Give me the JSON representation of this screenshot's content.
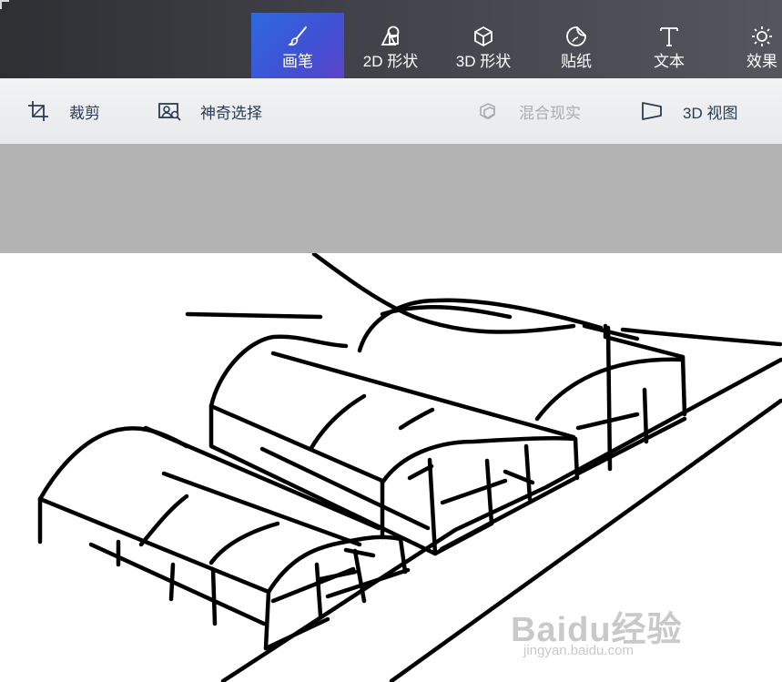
{
  "tabs": [
    {
      "id": "brushes",
      "label": "画笔",
      "icon": "brush-icon",
      "active": true
    },
    {
      "id": "shapes2d",
      "label": "2D 形状",
      "icon": "2d-shapes-icon",
      "active": false
    },
    {
      "id": "shapes3d",
      "label": "3D 形状",
      "icon": "3d-cube-icon",
      "active": false
    },
    {
      "id": "stickers",
      "label": "贴纸",
      "icon": "sticker-icon",
      "active": false
    },
    {
      "id": "text",
      "label": "文本",
      "icon": "text-icon",
      "active": false
    },
    {
      "id": "effects",
      "label": "效果",
      "icon": "effects-sun-icon",
      "active": false
    }
  ],
  "toolbar": {
    "crop_label": "裁剪",
    "magic_select_label": "神奇选择",
    "mixed_reality_label": "混合现实",
    "view3d_label": "3D 视图"
  },
  "watermark": {
    "brand": "Baidu经验",
    "url": "jingyan.baidu.com"
  },
  "colors": {
    "active_tab": "#3f52d6",
    "toolbar_text": "#2b3a55",
    "disabled_text": "#a9acb3",
    "canvas_surround": "#b3b3b3"
  }
}
